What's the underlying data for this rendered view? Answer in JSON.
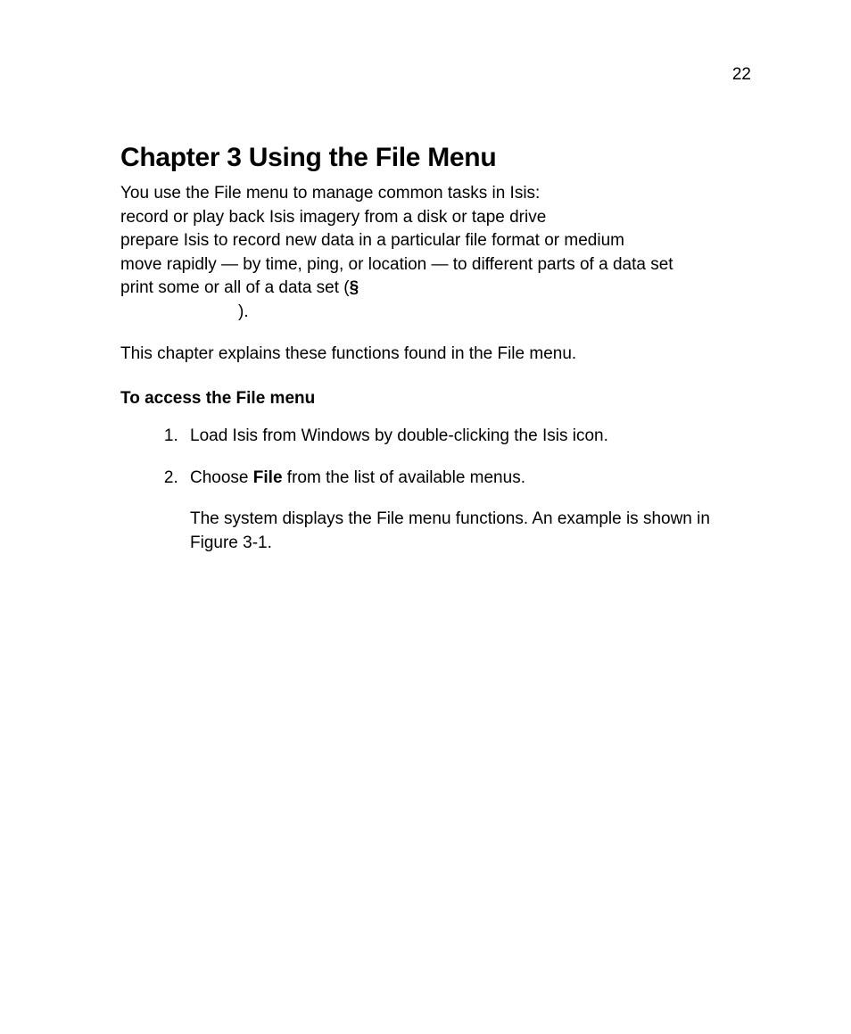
{
  "page_number": "22",
  "chapter_title": "Chapter 3 Using the File Menu",
  "intro": {
    "line1": "You use the File menu to manage common tasks in Isis:",
    "line2": "record or play back Isis imagery from a disk or tape drive",
    "line3": "prepare Isis to record new data in a particular file format or medium",
    "line4": "move rapidly — by time, ping, or location — to different parts of a data set",
    "line5_prefix": "print some or all of a data set (",
    "section_symbol": "§",
    "line6_paren": ")."
  },
  "explain_paragraph": "This chapter explains these functions found in the File menu.",
  "subhead": "To access the File menu",
  "steps": {
    "step1": "Load Isis from Windows by double-clicking the Isis icon.",
    "step2_prefix": "Choose ",
    "step2_bold": "File",
    "step2_suffix": " from the list of available menus.",
    "step2_body": "The system displays the File menu functions. An example is shown in Figure 3-1."
  }
}
